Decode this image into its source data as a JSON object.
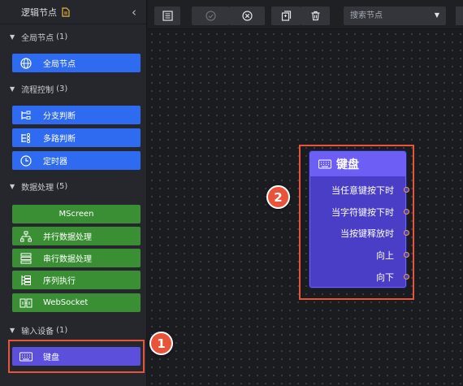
{
  "sidebar": {
    "title": "逻辑节点",
    "groups": [
      {
        "label": "全局节点",
        "count": "(1)",
        "items": [
          {
            "label": "全局节点",
            "icon": "globe-icon"
          }
        ]
      },
      {
        "label": "流程控制",
        "count": "(3)",
        "items": [
          {
            "label": "分支判断",
            "icon": "branch-icon"
          },
          {
            "label": "多路判断",
            "icon": "multi-branch-icon"
          },
          {
            "label": "定时器",
            "icon": "clock-icon"
          }
        ]
      },
      {
        "label": "数据处理",
        "count": "(5)",
        "items": [
          {
            "label": "MScreen",
            "icon": ""
          },
          {
            "label": "并行数据处理",
            "icon": "parallel-icon"
          },
          {
            "label": "串行数据处理",
            "icon": "serial-icon"
          },
          {
            "label": "序列执行",
            "icon": "sequence-icon"
          },
          {
            "label": "WebSocket",
            "icon": "websocket-icon"
          }
        ]
      },
      {
        "label": "输入设备",
        "count": "(1)",
        "items": [
          {
            "label": "键盘",
            "icon": "keyboard-icon"
          }
        ]
      }
    ]
  },
  "toolbar": {
    "search_placeholder": "搜索节点"
  },
  "node_card": {
    "title": "键盘",
    "ports": [
      "当任意键按下时",
      "当字符键按下时",
      "当按键释放时",
      "向上",
      "向下"
    ]
  },
  "badges": [
    "1",
    "2"
  ],
  "colors": {
    "accent_blue": "#2f6bf0",
    "accent_green": "#3a8f35",
    "accent_purple": "#5b4fdc",
    "highlight": "#e8533a",
    "port": "#f0a040"
  }
}
